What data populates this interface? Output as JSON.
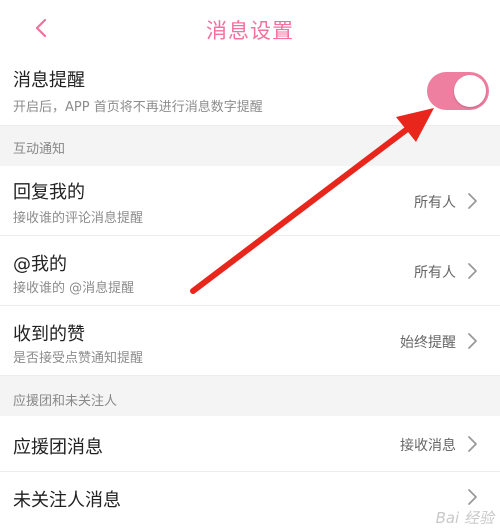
{
  "header": {
    "title": "消息设置",
    "back_icon": "chevron-left-icon"
  },
  "accent_color": "#f2719f",
  "badge_setting": {
    "title": "消息提醒",
    "subtitle": "开启后，APP 首页将不再进行消息数字提醒",
    "toggle_on": true
  },
  "sections": {
    "interaction": "互动通知",
    "support": "应援团和未关注人"
  },
  "rows": {
    "reply": {
      "title": "回复我的",
      "subtitle": "接收谁的评论消息提醒",
      "value": "所有人"
    },
    "mention": {
      "title": "@我的",
      "subtitle": "接收谁的 @消息提醒",
      "value": "所有人"
    },
    "likes": {
      "title": "收到的赞",
      "subtitle": "是否接受点赞通知提醒",
      "value": "始终提醒"
    },
    "support_msg": {
      "title": "应援团消息",
      "value": "接收消息"
    },
    "unfollowed": {
      "title": "未关注人消息"
    }
  },
  "watermark": "Bai 经验"
}
